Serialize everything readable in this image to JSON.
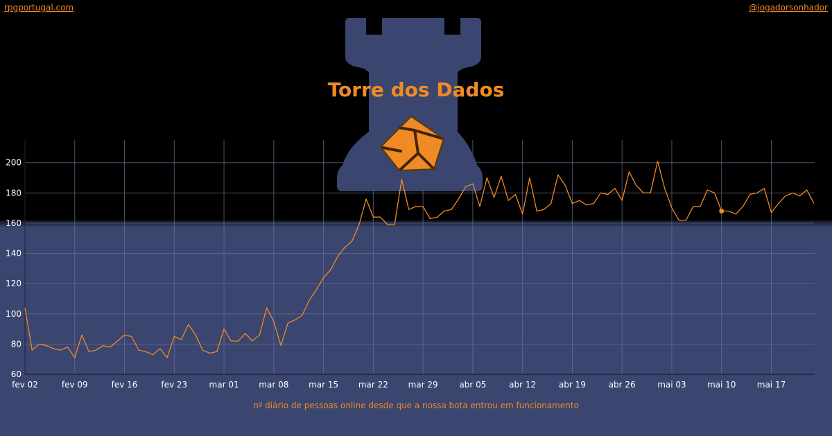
{
  "header": {
    "left_link": "rpgportugal.com",
    "right_link": "@jogadorsonhador"
  },
  "logo": {
    "title": "Torre dos Dados",
    "icon": "rook-tower-with-die-icon",
    "tower_color": "#3a4570",
    "die_color": "#f08a24"
  },
  "caption": "nº diário de pessoas online desde que a nossa bota entrou em funcionamento",
  "colors": {
    "background_top": "#000000",
    "background_bottom": "#3a4570",
    "line": "#f08a24",
    "text": "#ffffff",
    "grid": "#6b7396"
  },
  "chart_data": {
    "type": "line",
    "title": "",
    "xlabel": "",
    "ylabel": "",
    "x_start": "fev 02",
    "ylim": [
      60,
      215
    ],
    "yticks": [
      60,
      80,
      100,
      120,
      140,
      160,
      180,
      200
    ],
    "xtick_labels": [
      "fev 02",
      "fev 09",
      "fev 16",
      "fev 23",
      "mar 01",
      "mar 08",
      "mar 15",
      "mar 22",
      "mar 29",
      "abr 05",
      "abr 12",
      "abr 19",
      "abr 26",
      "mai 03",
      "mai 10",
      "mai 17"
    ],
    "grid": true,
    "legend": "none",
    "highlight_index": 98,
    "series": [
      {
        "values": [
          104,
          76,
          80,
          79,
          77,
          76,
          78,
          71,
          86,
          75,
          76,
          79,
          78,
          82,
          86,
          85,
          76,
          75,
          73,
          77,
          71,
          85,
          83,
          93,
          86,
          76,
          74,
          75,
          90,
          82,
          82,
          87,
          82,
          86,
          104,
          95,
          79,
          94,
          96,
          99,
          109,
          116,
          124,
          129,
          138,
          144,
          148,
          159,
          176,
          164,
          164,
          159,
          159,
          189,
          169,
          171,
          171,
          163,
          164,
          168,
          169,
          176,
          184,
          186,
          171,
          190,
          177,
          191,
          175,
          179,
          166,
          190,
          168,
          169,
          173,
          192,
          185,
          173,
          175,
          172,
          173,
          180,
          179,
          183,
          175,
          194,
          185,
          180,
          180,
          201,
          183,
          170,
          162,
          162,
          171,
          171,
          182,
          180,
          168,
          168,
          166,
          171,
          179,
          180,
          183,
          167,
          173,
          178,
          180,
          178,
          182,
          173
        ]
      }
    ]
  }
}
